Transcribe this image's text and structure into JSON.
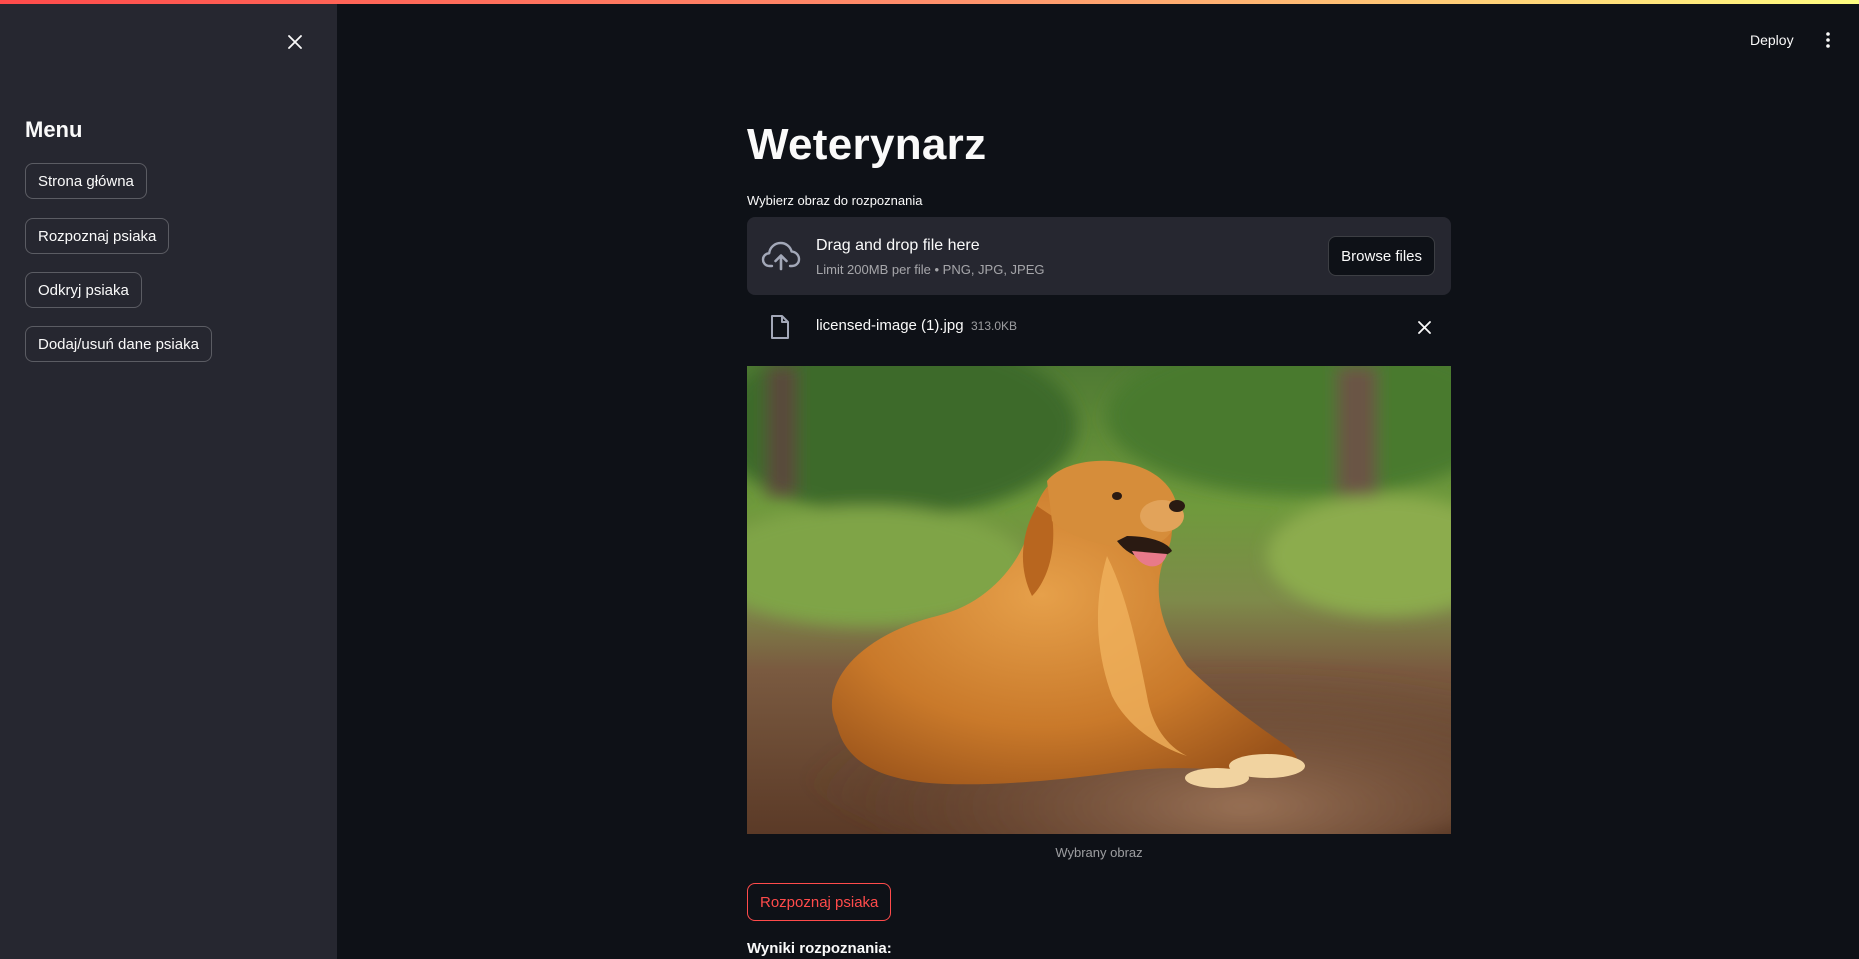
{
  "header": {
    "deploy_label": "Deploy",
    "more_icon": "vertical-dots-icon"
  },
  "sidebar": {
    "close_icon": "close-icon",
    "menu_title": "Menu",
    "items": [
      {
        "label": "Strona główna"
      },
      {
        "label": "Rozpoznaj psiaka"
      },
      {
        "label": "Odkryj psiaka"
      },
      {
        "label": "Dodaj/usuń dane psiaka"
      }
    ]
  },
  "main": {
    "title": "Weterynarz",
    "uploader": {
      "label": "Wybierz obraz do rozpoznania",
      "drop_title": "Drag and drop file here",
      "limit_text": "Limit 200MB per file • PNG, JPG, JPEG",
      "browse_label": "Browse files",
      "upload_icon": "cloud-upload-icon"
    },
    "file": {
      "name": "licensed-image (1).jpg",
      "size": "313.0KB",
      "file_icon": "file-icon",
      "remove_icon": "close-icon"
    },
    "image_caption": "Wybrany obraz",
    "recognize_button": "Rozpoznaj psiaka",
    "results_label": "Wyniki rozpoznania:"
  },
  "colors": {
    "background": "#0e1117",
    "sidebar": "#262730",
    "accent": "#ff4b4b",
    "text": "#fafafa"
  }
}
